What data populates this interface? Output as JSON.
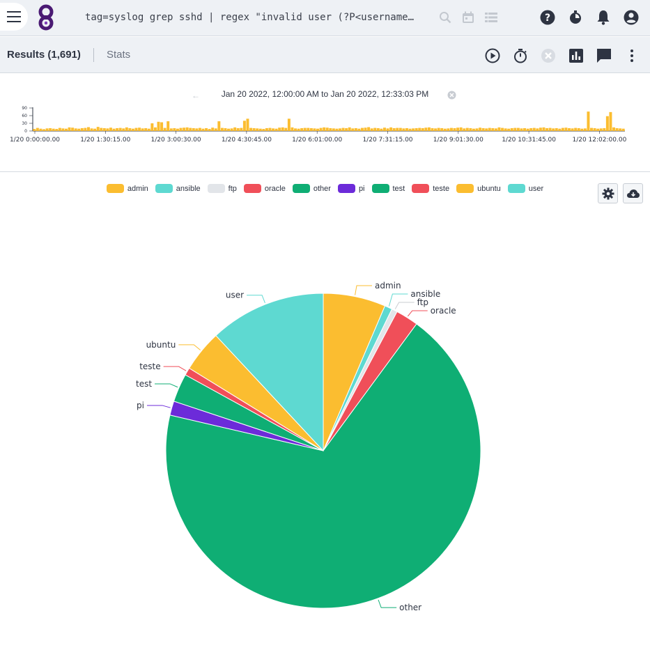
{
  "search": {
    "query": "tag=syslog grep sshd | regex \"invalid user (?P<username…"
  },
  "results": {
    "title": "Results (1,691)",
    "stats_tab": "Stats"
  },
  "timeline": {
    "range_text": "Jan 20 2022, 12:00:00 AM to Jan 20 2022, 12:33:03 PM",
    "y_ticks": [
      "90",
      "60",
      "30",
      "0"
    ],
    "x_ticks": [
      "1/20 0:00:00.00",
      "1/20 1:30:15.00",
      "1/20 3:00:30.00",
      "1/20 4:30:45.00",
      "1/20 6:01:00.00",
      "1/20 7:31:15.00",
      "1/20 9:01:30.00",
      "1/20 10:31:45.00",
      "1/20 12:02:00.00"
    ],
    "bar_color": "#fbbd30",
    "counts": [
      8,
      12,
      9,
      7,
      10,
      11,
      9,
      8,
      12,
      10,
      9,
      14,
      13,
      10,
      9,
      11,
      12,
      15,
      10,
      9,
      16,
      12,
      11,
      10,
      13,
      9,
      11,
      12,
      10,
      14,
      11,
      9,
      12,
      13,
      10,
      11,
      9,
      30,
      14,
      36,
      34,
      12,
      38,
      10,
      11,
      9,
      12,
      13,
      14,
      12,
      11,
      10,
      12,
      9,
      11,
      8,
      13,
      10,
      38,
      12,
      11,
      9,
      10,
      14,
      11,
      12,
      40,
      48,
      12,
      11,
      10,
      9,
      8,
      11,
      12,
      10,
      9,
      13,
      14,
      12,
      48,
      14,
      10,
      9,
      11,
      12,
      12,
      11,
      10,
      9,
      12,
      14,
      13,
      11,
      10,
      9,
      10,
      12,
      11,
      14,
      10,
      11,
      9,
      12,
      13,
      15,
      10,
      12,
      11,
      9,
      13,
      10,
      14,
      11,
      12,
      12,
      10,
      11,
      9,
      10,
      11,
      12,
      11,
      13,
      14,
      11,
      10,
      12,
      11,
      9,
      10,
      12,
      11,
      13,
      14,
      10,
      12,
      11,
      9,
      10,
      13,
      11,
      10,
      12,
      11,
      10,
      14,
      12,
      10,
      9,
      11,
      12,
      12,
      10,
      11,
      9,
      11,
      12,
      10,
      13,
      14,
      11,
      12,
      10,
      11,
      9,
      12,
      13,
      11,
      10,
      12,
      11,
      9,
      10,
      76,
      12,
      11,
      9,
      10,
      11,
      58,
      74,
      14,
      11,
      10,
      9
    ]
  },
  "legend": [
    {
      "name": "admin",
      "color": "#fbbd30"
    },
    {
      "name": "ansible",
      "color": "#5ed9d1"
    },
    {
      "name": "ftp",
      "color": "#e2e5e9"
    },
    {
      "name": "oracle",
      "color": "#f04f59"
    },
    {
      "name": "other",
      "color": "#0fae74"
    },
    {
      "name": "pi",
      "color": "#6c2bd9"
    },
    {
      "name": "test",
      "color": "#0fae74"
    },
    {
      "name": "teste",
      "color": "#f04f59"
    },
    {
      "name": "ubuntu",
      "color": "#fbbd30"
    },
    {
      "name": "user",
      "color": "#5ed9d1"
    }
  ],
  "chart_data": {
    "type": "pie",
    "slices": [
      {
        "name": "admin",
        "value": 6.6,
        "color": "#fbbd30"
      },
      {
        "name": "ansible",
        "value": 0.8,
        "color": "#5ed9d1"
      },
      {
        "name": "ftp",
        "value": 0.6,
        "color": "#e2e5e9"
      },
      {
        "name": "oracle",
        "value": 2.4,
        "color": "#f04f59"
      },
      {
        "name": "other",
        "value": 70.6,
        "color": "#0fae74"
      },
      {
        "name": "pi",
        "value": 1.5,
        "color": "#6c2bd9"
      },
      {
        "name": "test",
        "value": 3.0,
        "color": "#0fae74"
      },
      {
        "name": "teste",
        "value": 0.8,
        "color": "#f04f59"
      },
      {
        "name": "ubuntu",
        "value": 4.4,
        "color": "#fbbd30"
      },
      {
        "name": "user",
        "value": 12.3,
        "color": "#5ed9d1"
      }
    ]
  }
}
